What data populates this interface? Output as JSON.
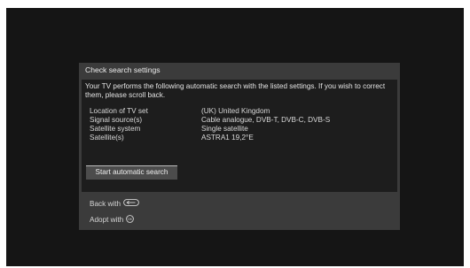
{
  "dialog": {
    "title": "Check search settings",
    "intro": "Your TV performs the following automatic search with the listed settings. If you wish to correct them, please scroll back.",
    "settings": [
      {
        "label": "Location of TV set",
        "value": "(UK) United Kingdom"
      },
      {
        "label": "Signal source(s)",
        "value": "Cable analogue, DVB-T, DVB-C, DVB-S"
      },
      {
        "label": "Satellite system",
        "value": "Single satellite"
      },
      {
        "label": "Satellite(s)",
        "value": "ASTRA1 19,2°E"
      }
    ],
    "start_button": "Start automatic search",
    "footer": {
      "back_label": "Back with",
      "back_icon": "back-key-icon",
      "adopt_label": "Adopt with",
      "adopt_icon": "ok-key-icon"
    }
  },
  "colors": {
    "screen_bg": "#151515",
    "dialog_bg": "#3b3b3b",
    "content_bg": "#1d1d1d",
    "button_bg": "#4c4c4c"
  }
}
